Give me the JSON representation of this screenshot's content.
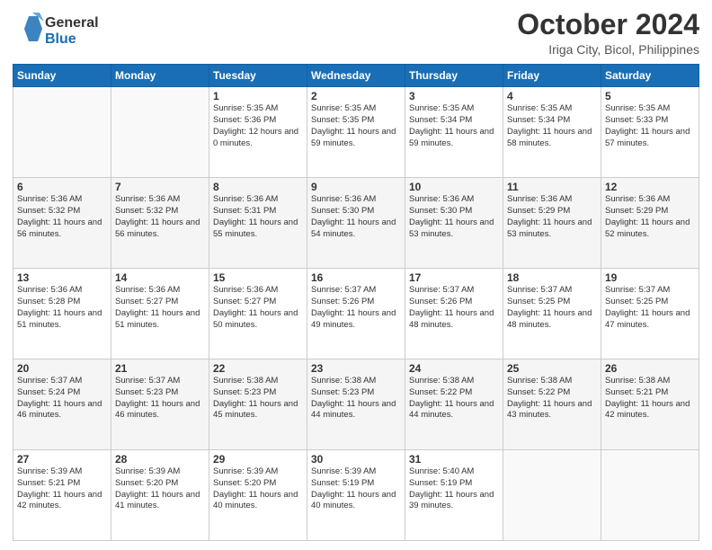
{
  "header": {
    "logo_general": "General",
    "logo_blue": "Blue",
    "month": "October 2024",
    "location": "Iriga City, Bicol, Philippines"
  },
  "days_of_week": [
    "Sunday",
    "Monday",
    "Tuesday",
    "Wednesday",
    "Thursday",
    "Friday",
    "Saturday"
  ],
  "weeks": [
    [
      {
        "day": "",
        "info": ""
      },
      {
        "day": "",
        "info": ""
      },
      {
        "day": "1",
        "sunrise": "Sunrise: 5:35 AM",
        "sunset": "Sunset: 5:36 PM",
        "daylight": "Daylight: 12 hours and 0 minutes."
      },
      {
        "day": "2",
        "sunrise": "Sunrise: 5:35 AM",
        "sunset": "Sunset: 5:35 PM",
        "daylight": "Daylight: 11 hours and 59 minutes."
      },
      {
        "day": "3",
        "sunrise": "Sunrise: 5:35 AM",
        "sunset": "Sunset: 5:34 PM",
        "daylight": "Daylight: 11 hours and 59 minutes."
      },
      {
        "day": "4",
        "sunrise": "Sunrise: 5:35 AM",
        "sunset": "Sunset: 5:34 PM",
        "daylight": "Daylight: 11 hours and 58 minutes."
      },
      {
        "day": "5",
        "sunrise": "Sunrise: 5:35 AM",
        "sunset": "Sunset: 5:33 PM",
        "daylight": "Daylight: 11 hours and 57 minutes."
      }
    ],
    [
      {
        "day": "6",
        "sunrise": "Sunrise: 5:36 AM",
        "sunset": "Sunset: 5:32 PM",
        "daylight": "Daylight: 11 hours and 56 minutes."
      },
      {
        "day": "7",
        "sunrise": "Sunrise: 5:36 AM",
        "sunset": "Sunset: 5:32 PM",
        "daylight": "Daylight: 11 hours and 56 minutes."
      },
      {
        "day": "8",
        "sunrise": "Sunrise: 5:36 AM",
        "sunset": "Sunset: 5:31 PM",
        "daylight": "Daylight: 11 hours and 55 minutes."
      },
      {
        "day": "9",
        "sunrise": "Sunrise: 5:36 AM",
        "sunset": "Sunset: 5:30 PM",
        "daylight": "Daylight: 11 hours and 54 minutes."
      },
      {
        "day": "10",
        "sunrise": "Sunrise: 5:36 AM",
        "sunset": "Sunset: 5:30 PM",
        "daylight": "Daylight: 11 hours and 53 minutes."
      },
      {
        "day": "11",
        "sunrise": "Sunrise: 5:36 AM",
        "sunset": "Sunset: 5:29 PM",
        "daylight": "Daylight: 11 hours and 53 minutes."
      },
      {
        "day": "12",
        "sunrise": "Sunrise: 5:36 AM",
        "sunset": "Sunset: 5:29 PM",
        "daylight": "Daylight: 11 hours and 52 minutes."
      }
    ],
    [
      {
        "day": "13",
        "sunrise": "Sunrise: 5:36 AM",
        "sunset": "Sunset: 5:28 PM",
        "daylight": "Daylight: 11 hours and 51 minutes."
      },
      {
        "day": "14",
        "sunrise": "Sunrise: 5:36 AM",
        "sunset": "Sunset: 5:27 PM",
        "daylight": "Daylight: 11 hours and 51 minutes."
      },
      {
        "day": "15",
        "sunrise": "Sunrise: 5:36 AM",
        "sunset": "Sunset: 5:27 PM",
        "daylight": "Daylight: 11 hours and 50 minutes."
      },
      {
        "day": "16",
        "sunrise": "Sunrise: 5:37 AM",
        "sunset": "Sunset: 5:26 PM",
        "daylight": "Daylight: 11 hours and 49 minutes."
      },
      {
        "day": "17",
        "sunrise": "Sunrise: 5:37 AM",
        "sunset": "Sunset: 5:26 PM",
        "daylight": "Daylight: 11 hours and 48 minutes."
      },
      {
        "day": "18",
        "sunrise": "Sunrise: 5:37 AM",
        "sunset": "Sunset: 5:25 PM",
        "daylight": "Daylight: 11 hours and 48 minutes."
      },
      {
        "day": "19",
        "sunrise": "Sunrise: 5:37 AM",
        "sunset": "Sunset: 5:25 PM",
        "daylight": "Daylight: 11 hours and 47 minutes."
      }
    ],
    [
      {
        "day": "20",
        "sunrise": "Sunrise: 5:37 AM",
        "sunset": "Sunset: 5:24 PM",
        "daylight": "Daylight: 11 hours and 46 minutes."
      },
      {
        "day": "21",
        "sunrise": "Sunrise: 5:37 AM",
        "sunset": "Sunset: 5:23 PM",
        "daylight": "Daylight: 11 hours and 46 minutes."
      },
      {
        "day": "22",
        "sunrise": "Sunrise: 5:38 AM",
        "sunset": "Sunset: 5:23 PM",
        "daylight": "Daylight: 11 hours and 45 minutes."
      },
      {
        "day": "23",
        "sunrise": "Sunrise: 5:38 AM",
        "sunset": "Sunset: 5:23 PM",
        "daylight": "Daylight: 11 hours and 44 minutes."
      },
      {
        "day": "24",
        "sunrise": "Sunrise: 5:38 AM",
        "sunset": "Sunset: 5:22 PM",
        "daylight": "Daylight: 11 hours and 44 minutes."
      },
      {
        "day": "25",
        "sunrise": "Sunrise: 5:38 AM",
        "sunset": "Sunset: 5:22 PM",
        "daylight": "Daylight: 11 hours and 43 minutes."
      },
      {
        "day": "26",
        "sunrise": "Sunrise: 5:38 AM",
        "sunset": "Sunset: 5:21 PM",
        "daylight": "Daylight: 11 hours and 42 minutes."
      }
    ],
    [
      {
        "day": "27",
        "sunrise": "Sunrise: 5:39 AM",
        "sunset": "Sunset: 5:21 PM",
        "daylight": "Daylight: 11 hours and 42 minutes."
      },
      {
        "day": "28",
        "sunrise": "Sunrise: 5:39 AM",
        "sunset": "Sunset: 5:20 PM",
        "daylight": "Daylight: 11 hours and 41 minutes."
      },
      {
        "day": "29",
        "sunrise": "Sunrise: 5:39 AM",
        "sunset": "Sunset: 5:20 PM",
        "daylight": "Daylight: 11 hours and 40 minutes."
      },
      {
        "day": "30",
        "sunrise": "Sunrise: 5:39 AM",
        "sunset": "Sunset: 5:19 PM",
        "daylight": "Daylight: 11 hours and 40 minutes."
      },
      {
        "day": "31",
        "sunrise": "Sunrise: 5:40 AM",
        "sunset": "Sunset: 5:19 PM",
        "daylight": "Daylight: 11 hours and 39 minutes."
      },
      {
        "day": "",
        "info": ""
      },
      {
        "day": "",
        "info": ""
      }
    ]
  ]
}
